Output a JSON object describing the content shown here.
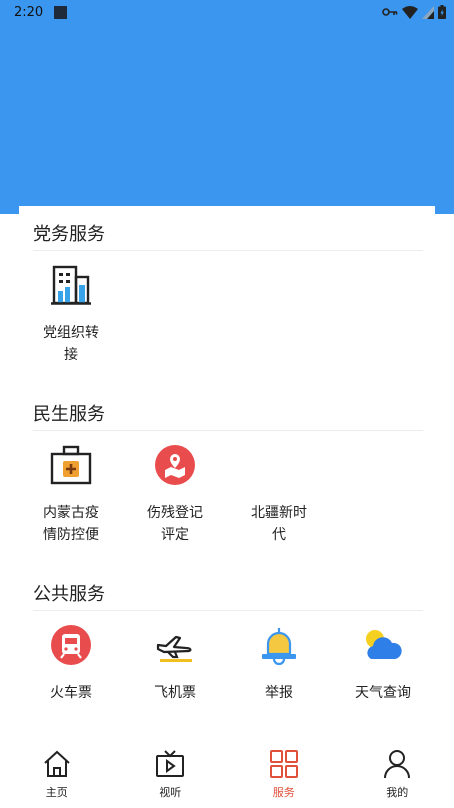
{
  "status_bar": {
    "time": "2:20"
  },
  "sections": [
    {
      "title": "党务服务",
      "items": [
        {
          "label": "党组织转接",
          "icon": "building-icon"
        }
      ]
    },
    {
      "title": "民生服务",
      "items": [
        {
          "label": "内蒙古疫情防控便",
          "icon": "medical-kit-icon"
        },
        {
          "label": "伤残登记评定",
          "icon": "map-pin-icon"
        },
        {
          "label": "北疆新时代",
          "icon": ""
        }
      ]
    },
    {
      "title": "公共服务",
      "items": [
        {
          "label": "火车票",
          "icon": "train-icon"
        },
        {
          "label": "飞机票",
          "icon": "airplane-icon"
        },
        {
          "label": "举报",
          "icon": "bell-icon"
        },
        {
          "label": "天气查询",
          "icon": "weather-icon"
        }
      ]
    }
  ],
  "bottom_nav": [
    {
      "label": "主页",
      "icon": "home-icon"
    },
    {
      "label": "视听",
      "icon": "tv-icon"
    },
    {
      "label": "服务",
      "icon": "grid-icon",
      "active": true
    },
    {
      "label": "我的",
      "icon": "person-icon"
    }
  ],
  "colors": {
    "primary_blue": "#3a96ee",
    "active_red": "#e0503a"
  }
}
